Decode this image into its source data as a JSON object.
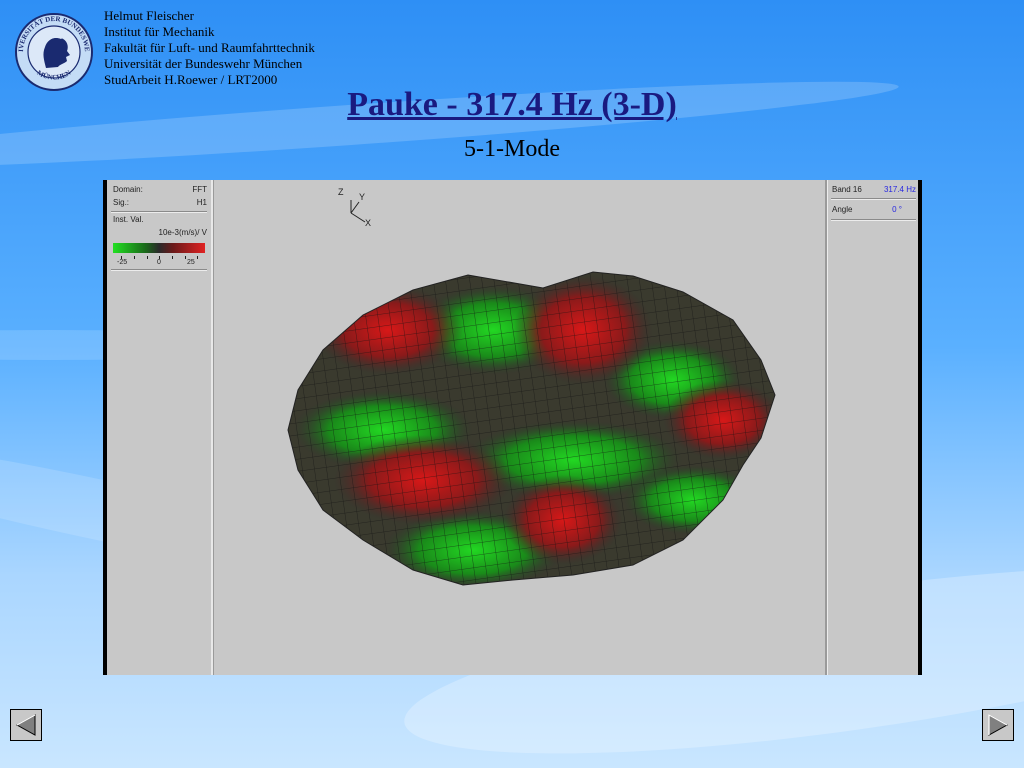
{
  "author": {
    "name": "Helmut Fleischer",
    "institute": "Institut für Mechanik",
    "faculty": "Fakultät für Luft- und Raumfahrttechnik",
    "university": "Universität der Bundeswehr München",
    "project": "StudArbeit H.Roewer / LRT2000"
  },
  "logo": {
    "top_text": "UNIVERSITÄT DER BUNDESWEHR",
    "bottom_text": "MÜNCHEN"
  },
  "slide": {
    "title": "Pauke - 317.4 Hz (3-D)",
    "subtitle": "5-1-Mode"
  },
  "screenshot": {
    "left_panel": {
      "domain_label": "Domain:",
      "domain_value": "FFT",
      "sig_label": "Sig.:",
      "sig_value": "H1",
      "inst_val_label": "Inst. Val.",
      "units": "10e-3(m/s)/ V",
      "scale_min": "-25",
      "scale_mid": "0",
      "scale_max": "25"
    },
    "axes": {
      "z": "Z",
      "y": "Y",
      "x": "X"
    },
    "right_panel": {
      "band_label": "Band 16",
      "band_value": "317.4 Hz",
      "angle_label": "Angle",
      "angle_value": "0 °"
    },
    "colors": {
      "positive": "#e02222",
      "negative": "#22e022",
      "neutral": "#2a2a2a",
      "frequency_text": "#2828e0"
    }
  },
  "navigation": {
    "prev_icon": "triangle-left-icon",
    "next_icon": "triangle-right-icon"
  }
}
